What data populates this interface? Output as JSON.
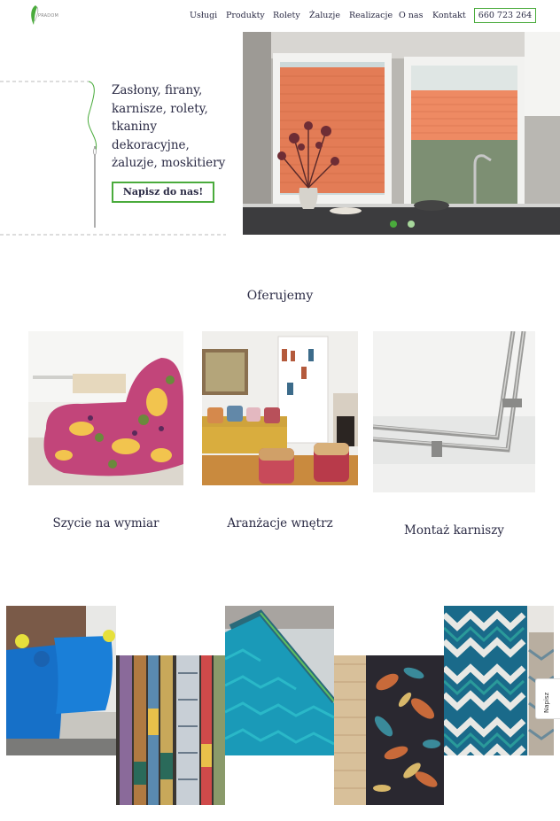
{
  "header": {
    "logo_text": "PRADOM",
    "nav": [
      "Usługi",
      "Produkty",
      "Rolety",
      "Żaluzje",
      "Realizacje",
      "O nas",
      "Kontakt"
    ],
    "phone": "660 723 264"
  },
  "hero": {
    "headline": "Zasłony, firany, karnisze, rolety, tkaniny dekoracyjne, żaluzje, moskitiery",
    "cta": "Napisz do nas!",
    "slider": {
      "count": 2,
      "active": 1
    }
  },
  "offer": {
    "title": "Oferujemy",
    "items": [
      {
        "label": "Szycie na wymiar",
        "image": "paisley-armchair-photo"
      },
      {
        "label": "Aranżacje wnętrz",
        "image": "living-room-photo"
      },
      {
        "label": "Montaż karniszy",
        "image": "curtain-rod-photo"
      }
    ]
  },
  "gallery": {
    "images": [
      "blue-pillows-photo",
      "fabric-samples-photo",
      "pleated-blind-photo",
      "leaf-curtain-photo",
      "chevron-fabric-photo"
    ]
  },
  "side_tab": {
    "label": "Napisz"
  },
  "colors": {
    "accent": "#4aab3c",
    "text": "#2b2b45",
    "dot_active": "#4aab3c",
    "dot_inactive": "#a8d89c"
  }
}
